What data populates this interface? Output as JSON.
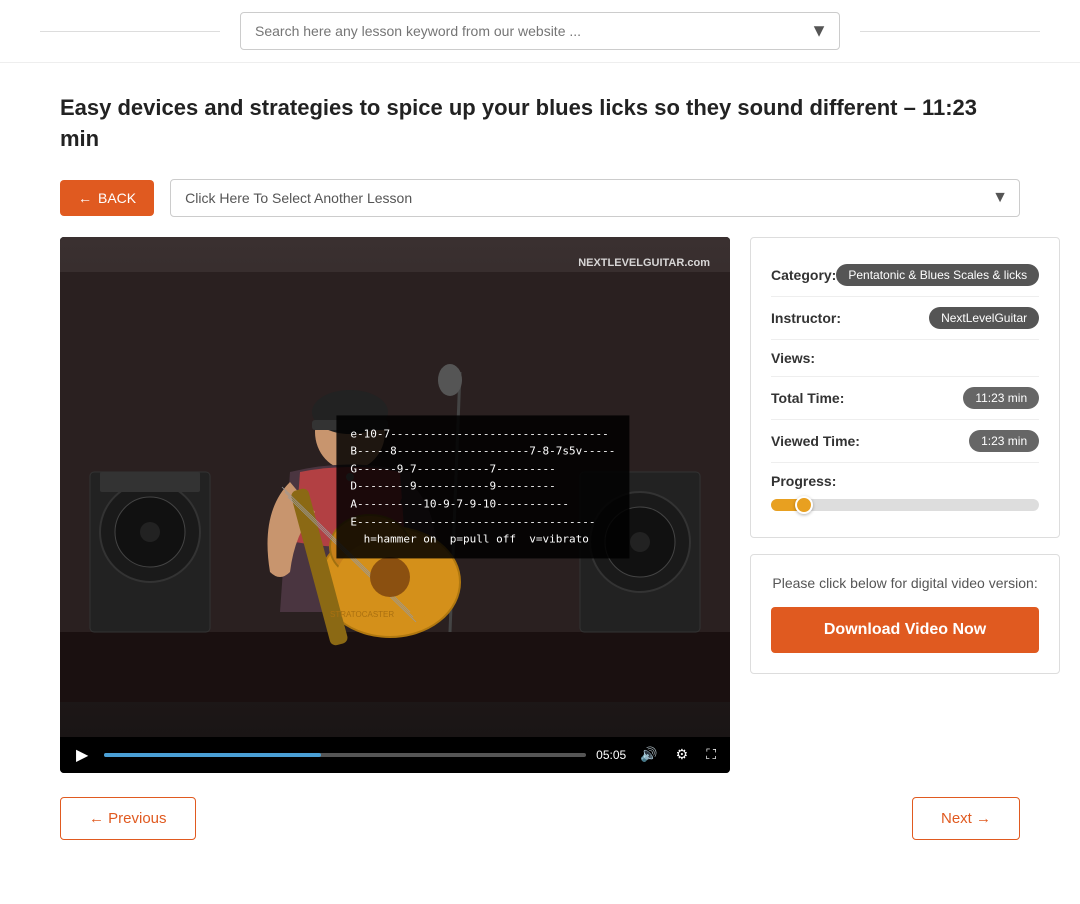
{
  "header": {
    "search_placeholder": "Search here any lesson keyword from our website ..."
  },
  "page": {
    "title": "Easy devices and strategies to spice up your blues licks so they sound different – 11:23 min",
    "back_label": "BACK",
    "lesson_select_placeholder": "Click Here To Select Another Lesson"
  },
  "video": {
    "current_time": "05:05",
    "progress_percent": 45,
    "tab_notation": "e-10-7---------------------------------\nB-----8--------------------7-8-7s5v-----\nG------9-7-----------7---------\nD--------9-----------9---------\nA----------10-9-7-9-10-----------\nE------------------------------------\n  h=hammer on  p=pull off  v=vibrato",
    "brand": "NEXTLEVELGUITAR.com"
  },
  "sidebar": {
    "category_label": "Category:",
    "category_value": "Pentatonic & Blues Scales & licks",
    "instructor_label": "Instructor:",
    "instructor_value": "NextLevelGuitar",
    "views_label": "Views:",
    "views_value": "",
    "total_time_label": "Total Time:",
    "total_time_value": "11:23 min",
    "viewed_time_label": "Viewed Time:",
    "viewed_time_value": "1:23 min",
    "progress_label": "Progress:",
    "progress_percent": 12,
    "download_prompt": "Please click below for digital video version:",
    "download_button_label": "Download Video Now"
  },
  "navigation": {
    "previous_label": "← Previous",
    "next_label": "Next →"
  }
}
